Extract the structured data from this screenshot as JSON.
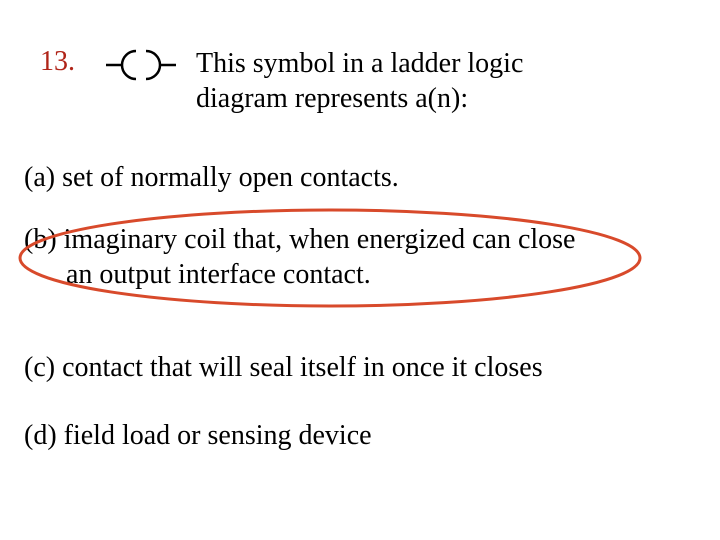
{
  "question": {
    "number": "13.",
    "stem_line1": "This symbol in a ladder logic",
    "stem_line2": "diagram represents a(n):"
  },
  "options": {
    "a": "(a) set  of normally open contacts.",
    "b_line1": "(b) imaginary coil that, when energized can close",
    "b_line2": "an output interface contact.",
    "c": "(c) contact that will seal itself in once it closes",
    "d": "(d) field load or sensing device"
  },
  "answer": {
    "correct_option": "b",
    "highlight_color": "#d84a2b"
  },
  "symbol": {
    "name": "output-coil"
  }
}
